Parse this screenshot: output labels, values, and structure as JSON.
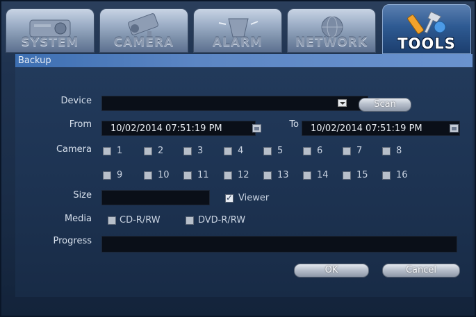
{
  "tabs": [
    {
      "label": "SYSTEM",
      "icon": "projector-icon",
      "active": false
    },
    {
      "label": "CAMERA",
      "icon": "camera-icon",
      "active": false
    },
    {
      "label": "ALARM",
      "icon": "alarm-siren-icon",
      "active": false
    },
    {
      "label": "NETWORK",
      "icon": "network-icon",
      "active": false
    },
    {
      "label": "TOOLS",
      "icon": "tools-icon",
      "active": true
    }
  ],
  "section": {
    "title": "Backup"
  },
  "form": {
    "device_label": "Device",
    "device_value": "",
    "scan_label": "Scan",
    "from_label": "From",
    "from_value": "10/02/2014 07:51:19 PM",
    "to_label": "To",
    "to_value": "10/02/2014 07:51:19 PM",
    "camera_label": "Camera",
    "cameras": [
      "1",
      "2",
      "3",
      "4",
      "5",
      "6",
      "7",
      "8",
      "9",
      "10",
      "11",
      "12",
      "13",
      "14",
      "15",
      "16"
    ],
    "size_label": "Size",
    "size_value": "",
    "viewer_label": "Viewer",
    "viewer_checked": true,
    "media_label": "Media",
    "media_options": [
      "CD-R/RW",
      "DVD-R/RW"
    ],
    "progress_label": "Progress",
    "progress": 0
  },
  "buttons": {
    "ok": "OK",
    "cancel": "Cancel"
  },
  "colors": {
    "header_bar": "#5c86c4",
    "panel": "#1d3352",
    "field": "#0a0f18"
  }
}
